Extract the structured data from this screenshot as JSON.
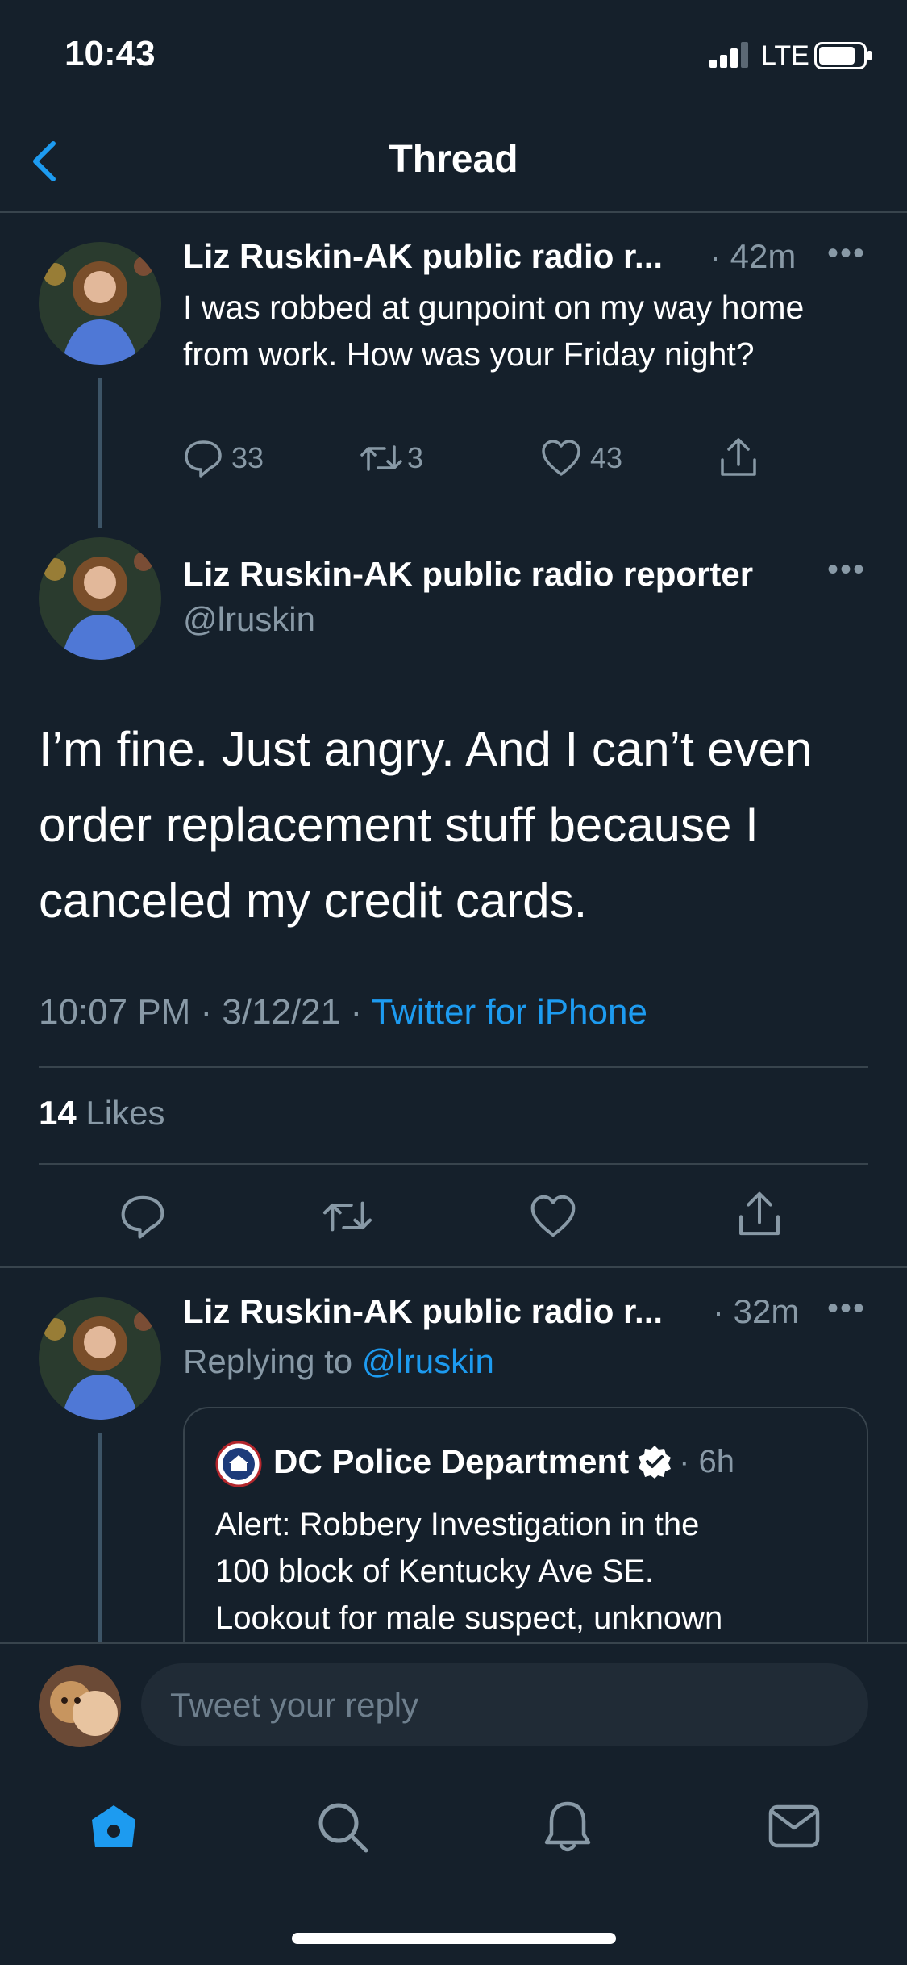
{
  "status_bar": {
    "time": "10:43",
    "network": "LTE"
  },
  "header": {
    "title": "Thread",
    "back_icon": "chevron-left-icon"
  },
  "parent_tweet": {
    "display_name": "Liz Ruskin-AK public radio r...",
    "time": "· 42m",
    "text": "I was robbed at gunpoint on my way home from work. How was your Friday night?",
    "replies": "33",
    "retweets": "3",
    "likes": "43"
  },
  "main_tweet": {
    "display_name": "Liz Ruskin-AK public radio reporter",
    "handle": "@lruskin",
    "text": "I’m fine. Just angry. And I can’t even order replacement stuff because I canceled my credit cards.",
    "timestamp": "10:07 PM · 3/12/21 · ",
    "source": "Twitter for iPhone",
    "likes_count": "14",
    "likes_label": "Likes"
  },
  "reply_tweet": {
    "display_name": "Liz Ruskin-AK public radio r...",
    "time": "· 32m",
    "replying_prefix": "Replying to ",
    "replying_handle": "@lruskin",
    "quoted": {
      "name": "DC Police Department",
      "time": "· 6h",
      "text_lines": [
        "Alert: Robbery Investigation in the",
        "100 block of Kentucky Ave SE.",
        "Lookout for male suspect, unknown"
      ]
    }
  },
  "composer": {
    "placeholder": "Tweet your reply"
  },
  "tab_bar": {
    "items": [
      "home-icon",
      "search-icon",
      "notifications-icon",
      "messages-icon"
    ]
  },
  "colors": {
    "background": "#15202b",
    "accent": "#1d9bf0",
    "muted": "#8899a6",
    "divider": "#38444d"
  }
}
